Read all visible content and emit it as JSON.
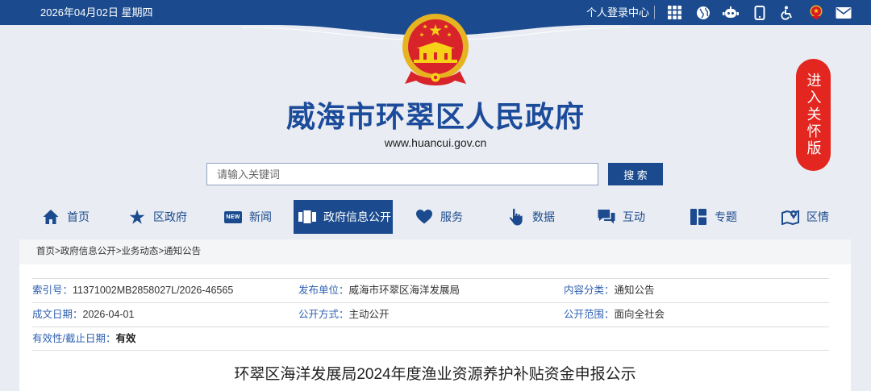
{
  "top_bar": {
    "date": "2026年04月02日 星期四",
    "login_link": "个人登录中心",
    "icons": [
      "grid-icon",
      "globe-icon",
      "robot-icon",
      "mobile-icon",
      "accessibility-icon",
      "emblem-icon",
      "mail-icon"
    ]
  },
  "header": {
    "emblem": "national-emblem",
    "site_title": "威海市环翠区人民政府",
    "site_url": "www.huancui.gov.cn",
    "care_version_button": "进入关怀版"
  },
  "search": {
    "placeholder": "请输入关键词",
    "button_label": "搜 索"
  },
  "nav": {
    "active_index": 3,
    "items": [
      {
        "label": "首页",
        "icon": "home-icon"
      },
      {
        "label": "区政府",
        "icon": "star-icon"
      },
      {
        "label": "新闻",
        "icon": "new-badge-icon",
        "icon_text": "NEW"
      },
      {
        "label": "政府信息公开",
        "icon": "document-icon"
      },
      {
        "label": "服务",
        "icon": "heart-icon"
      },
      {
        "label": "数据",
        "icon": "hand-pointer-icon"
      },
      {
        "label": "互动",
        "icon": "chat-icon"
      },
      {
        "label": "专题",
        "icon": "blocks-icon"
      },
      {
        "label": "区情",
        "icon": "map-icon"
      }
    ]
  },
  "breadcrumb": {
    "separator": ">",
    "items": [
      "首页",
      "政府信息公开",
      "业务动态",
      "通知公告"
    ]
  },
  "info": {
    "rows": [
      [
        {
          "label": "索引号：",
          "value": "11371002MB2858027L/2026-46565"
        },
        {
          "label": "发布单位：",
          "value": "威海市环翠区海洋发展局"
        },
        {
          "label": "内容分类：",
          "value": "通知公告"
        }
      ],
      [
        {
          "label": "成文日期：",
          "value": "2026-04-01"
        },
        {
          "label": "公开方式：",
          "value": "主动公开"
        },
        {
          "label": "公开范围：",
          "value": "面向全社会"
        }
      ],
      [
        {
          "label": "有效性/截止日期：",
          "value": "有效"
        }
      ]
    ]
  },
  "article": {
    "title": "环翠区海洋发展局2024年度渔业资源养护补贴资金申报公示"
  },
  "colors": {
    "primary": "#1b4b8e",
    "title_blue": "#1b4b9a",
    "accent_red": "#e3261f",
    "label_blue": "#2d5fb0",
    "header_bg": "#e9ecf2"
  }
}
